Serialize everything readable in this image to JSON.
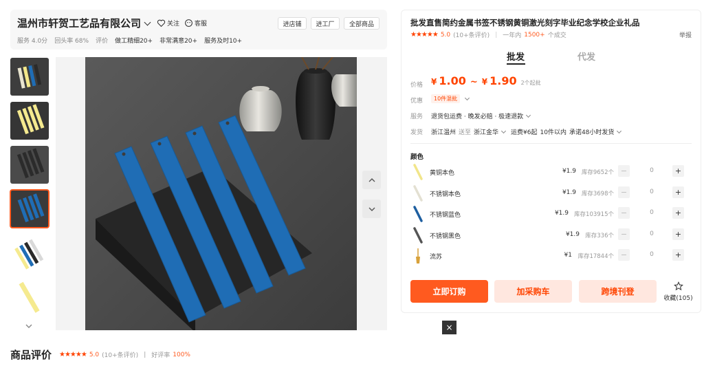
{
  "shop": {
    "name": "温州市轩贺工艺品有限公司",
    "follow": "关注",
    "service": "客服",
    "buttons": [
      "进店铺",
      "进工厂",
      "全部商品"
    ],
    "stats": {
      "service_score": "服务 4.0分",
      "repurchase": "回头率 68%",
      "eval_label": "评价",
      "tags": [
        "做工精细20+",
        "非常满意20+",
        "服务及时10+"
      ]
    }
  },
  "reviews_footer": {
    "title": "商品评价",
    "rating": "5.0",
    "count": "(10+条评价)",
    "sep": "|",
    "good_label": "好评率",
    "good_rate": "100%"
  },
  "product": {
    "title": "批发直售简约金属书签不锈钢黄铜激光刻字毕业纪念学校企业礼品",
    "rating": "5.0",
    "rating_count": "(10+条评价)",
    "sep": "|",
    "sales_prefix": "一年内",
    "sales_num": "1500+",
    "sales_suffix": "个成交",
    "report": "举报",
    "tabs": {
      "wholesale": "批发",
      "dropship": "代发"
    },
    "price_label": "价格",
    "price_low": "1.00",
    "price_sep": "~",
    "price_high": "1.90",
    "price_note": "2个起批",
    "yen": "¥",
    "promo_label": "优惠",
    "coupon": "10件混批",
    "service_label": "服务",
    "service_text": "退货包运费 · 晚发必赔 · 极速退款",
    "ship_label": "发货",
    "ship_from": "浙江温州",
    "ship_to_word": "送至",
    "ship_to": "浙江金华",
    "ship_fee": "运费¥6起",
    "ship_qty": "10件以内",
    "ship_promise": "承诺48小时发货",
    "color_label": "颜色",
    "skus": [
      {
        "name": "黄铜本色",
        "price": "¥1.9",
        "stock": "库存9652个",
        "qty": "0",
        "color": "#f1e58a"
      },
      {
        "name": "不锈钢本色",
        "price": "¥1.9",
        "stock": "库存3698个",
        "qty": "0",
        "color": "#e3e0d2"
      },
      {
        "name": "不锈钢蓝色",
        "price": "¥1.9",
        "stock": "库存103915个",
        "qty": "0",
        "color": "#1e5fa0"
      },
      {
        "name": "不锈钢黑色",
        "price": "¥1.9",
        "stock": "库存336个",
        "qty": "0",
        "color": "#555555"
      },
      {
        "name": "流苏",
        "price": "¥1",
        "stock": "库存17844个",
        "qty": "0",
        "color": "#d8a13a"
      }
    ],
    "buy_now": "立即订购",
    "add_cart": "加采购车",
    "cross_border": "跨境刊登",
    "favorite": "收藏(105)"
  },
  "controls": {
    "minus": "−",
    "plus": "+",
    "close": "×"
  },
  "colors": {
    "accent": "#ff5a1f",
    "price": "#ff4400",
    "blue_bookmark": "#1f6db5"
  }
}
